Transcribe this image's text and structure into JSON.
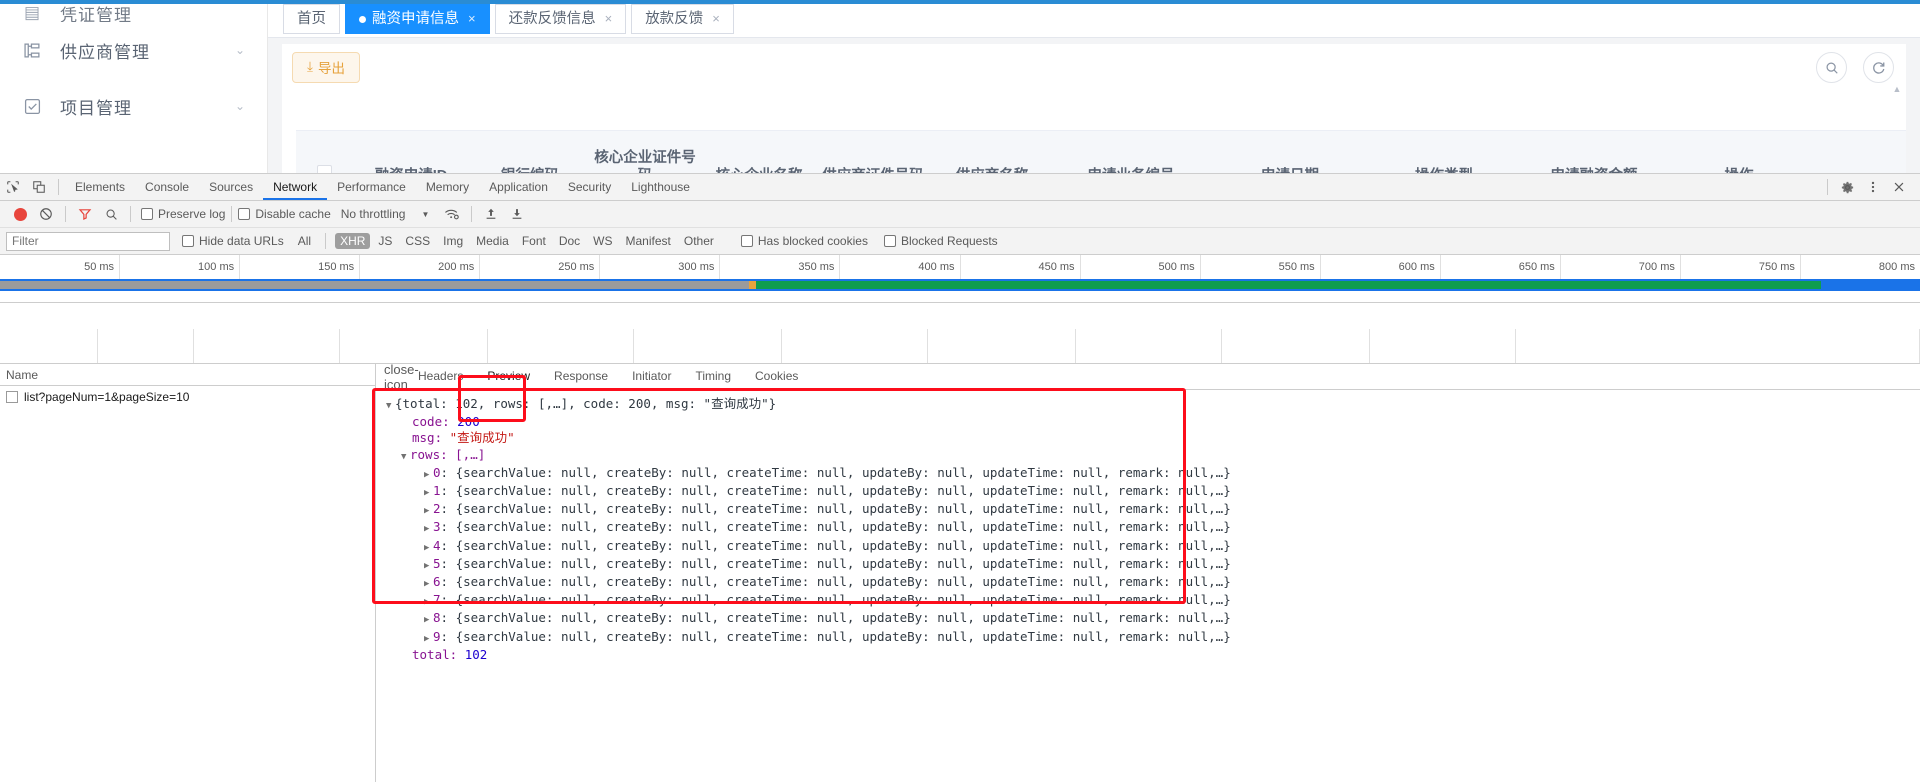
{
  "app": {
    "sidebar": {
      "items": [
        {
          "label": "凭证管理",
          "icon": "doc-icon",
          "arrow": ""
        },
        {
          "label": "供应商管理",
          "icon": "org-tree-icon",
          "arrow": "⌄"
        },
        {
          "label": "项目管理",
          "icon": "checkbox-square-icon",
          "arrow": "⌄"
        }
      ]
    },
    "tabs": [
      {
        "label": "首页",
        "active": false,
        "closable": false
      },
      {
        "label": "融资申请信息",
        "active": true,
        "closable": true,
        "close": "×"
      },
      {
        "label": "还款反馈信息",
        "active": false,
        "closable": true,
        "close": "×"
      },
      {
        "label": "放款反馈",
        "active": false,
        "closable": true,
        "close": "×"
      }
    ],
    "toolbar": {
      "export_label": "导出",
      "export_icon": "download-icon",
      "search_icon": "search-icon",
      "refresh_icon": "refresh-icon"
    },
    "table": {
      "select_all": "select-all-checkbox",
      "columns": [
        "融资申请ID",
        "银行编码",
        "核心企业证件号码",
        "核心企业名称",
        "供应商证件号码",
        "供应商名称",
        "申请业务编号",
        "申请日期",
        "操作类型",
        "申请融资金额",
        "操作"
      ]
    }
  },
  "devtools": {
    "left_icons": [
      "inspect-element-icon",
      "device-toolbar-icon"
    ],
    "panels": [
      {
        "label": "Elements",
        "active": false
      },
      {
        "label": "Console",
        "active": false
      },
      {
        "label": "Sources",
        "active": false
      },
      {
        "label": "Network",
        "active": true
      },
      {
        "label": "Performance",
        "active": false
      },
      {
        "label": "Memory",
        "active": false
      },
      {
        "label": "Application",
        "active": false
      },
      {
        "label": "Security",
        "active": false
      },
      {
        "label": "Lighthouse",
        "active": false
      }
    ],
    "right_icons": [
      "settings-gear-icon",
      "more-vertical-icon",
      "close-icon"
    ],
    "toolbar": {
      "record_icon": "record-stop-icon",
      "clear_icon": "clear-icon",
      "filter_icon": "filter-funnel-icon",
      "search_icon": "search-icon",
      "preserve_log": "Preserve log",
      "disable_cache": "Disable cache",
      "throttling": "No throttling",
      "throttle_caret": "▼",
      "wifi_icon": "network-conditions-icon",
      "import_icon": "import-har-icon",
      "export_icon": "export-har-icon"
    },
    "filterbar": {
      "filter_placeholder": "Filter",
      "filter_value": "",
      "hide_data_urls": "Hide data URLs",
      "types": [
        {
          "label": "All",
          "active": false
        },
        {
          "label": "XHR",
          "active": true
        },
        {
          "label": "JS",
          "active": false
        },
        {
          "label": "CSS",
          "active": false
        },
        {
          "label": "Img",
          "active": false
        },
        {
          "label": "Media",
          "active": false
        },
        {
          "label": "Font",
          "active": false
        },
        {
          "label": "Doc",
          "active": false
        },
        {
          "label": "WS",
          "active": false
        },
        {
          "label": "Manifest",
          "active": false
        },
        {
          "label": "Other",
          "active": false
        }
      ],
      "has_blocked_cookies": "Has blocked cookies",
      "blocked_requests": "Blocked Requests"
    },
    "overview": {
      "ticks": [
        "50 ms",
        "100 ms",
        "150 ms",
        "200 ms",
        "250 ms",
        "300 ms",
        "350 ms",
        "400 ms",
        "450 ms",
        "500 ms",
        "550 ms",
        "600 ms",
        "650 ms",
        "700 ms",
        "750 ms",
        "800 ms"
      ]
    },
    "requests": {
      "header": "Name",
      "rows": [
        "list?pageNum=1&pageSize=10"
      ]
    },
    "detail": {
      "close_icon": "close-icon",
      "tabs": [
        {
          "label": "Headers",
          "active": false
        },
        {
          "label": "Preview",
          "active": true
        },
        {
          "label": "Response",
          "active": false
        },
        {
          "label": "Initiator",
          "active": false
        },
        {
          "label": "Timing",
          "active": false
        },
        {
          "label": "Cookies",
          "active": false
        }
      ],
      "preview": {
        "root": "{total: 102, rows: [,…], code: 200, msg: \"查询成功\"}",
        "code_key": "code: ",
        "code_value": "200",
        "msg_key": "msg: ",
        "msg_value": "\"查询成功\"",
        "rows_label": "rows: [,…]",
        "row_body": "{searchValue: null, createBy: null, createTime: null, updateBy: null, updateTime: null, remark: null,…}",
        "row_indices": [
          "0",
          "1",
          "2",
          "3",
          "4",
          "5",
          "6",
          "7",
          "8",
          "9"
        ],
        "total_key": "total: ",
        "total_value": "102"
      }
    },
    "annotations": [
      {
        "name": "preview-tab-highlight"
      },
      {
        "name": "rows-data-highlight"
      }
    ]
  }
}
